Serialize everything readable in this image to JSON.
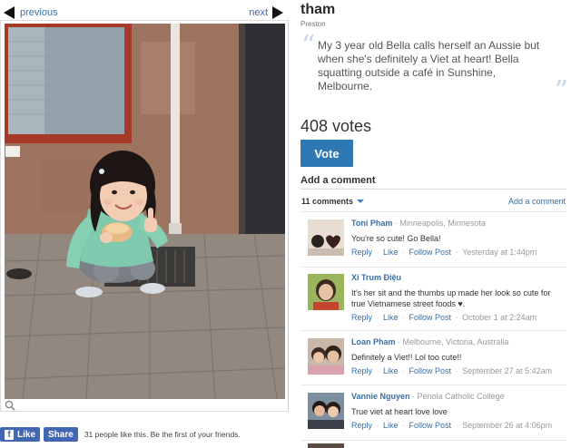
{
  "nav": {
    "previous_label": "previous",
    "next_label": "next"
  },
  "social": {
    "like_label": "Like",
    "share_label": "Share",
    "like_summary": "31 people like this. Be the first of your friends."
  },
  "entry": {
    "author": "tham",
    "location": "Preston",
    "caption": "My 3 year old Bella calls herself an Aussie but when she's definitely a Viet at heart! Bella squatting outside a café in Sunshine, Melbourne.",
    "votes": "408 votes",
    "vote_label": "Vote"
  },
  "comments_section": {
    "heading": "Add a comment",
    "count_label": "11 comments",
    "add_link": "Add a comment",
    "action_reply": "Reply",
    "action_like": "Like",
    "action_follow": "Follow Post",
    "items": [
      {
        "name": "Toni Pham",
        "location": "Minneapolis, Minnesota",
        "text": "You're so cute! Go Bella!",
        "time": "Yesterday at 1:44pm"
      },
      {
        "name": "Xi Trum Điệu",
        "location": "",
        "text": "It's her sit and the thumbs up made her look so cute for true Vietnamese street foods ♥.",
        "time": "October 1 at 2:24am"
      },
      {
        "name": "Loan Pham",
        "location": "Melbourne, Victoria, Australia",
        "text": "Definitely a Viet!! Lol too cute!!",
        "time": "September 27 at 5:42am"
      },
      {
        "name": "Vannie Nguyen",
        "location": "Penola Catholic College",
        "text": "True viet at heart love love",
        "time": "September 26 at 4:06pm"
      }
    ]
  },
  "colors": {
    "link": "#3b6ea5",
    "vote_button": "#2e78b4",
    "facebook": "#4267b2"
  }
}
